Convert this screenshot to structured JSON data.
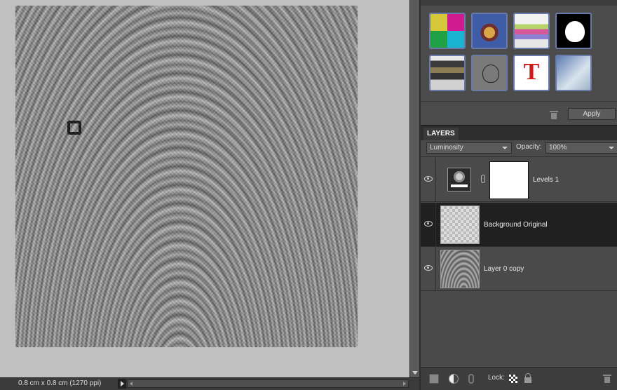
{
  "status": {
    "doc_size": "0.8 cm x 0.8 cm (1270 ppi)"
  },
  "effects": {
    "thumbnails": [
      "effect-thumb-1",
      "effect-thumb-2",
      "effect-thumb-3",
      "effect-thumb-4",
      "effect-thumb-5",
      "effect-thumb-6",
      "effect-thumb-7",
      "effect-thumb-8"
    ],
    "text_effect_glyph": "T",
    "apply_label": "Apply"
  },
  "layers": {
    "tab_label": "LAYERS",
    "blend_mode": "Luminosity",
    "opacity_label": "Opacity:",
    "opacity_value": "100%",
    "items": [
      {
        "name": "Levels 1",
        "selected": false
      },
      {
        "name": "Background Original",
        "selected": true
      },
      {
        "name": "Layer 0 copy",
        "selected": false
      }
    ],
    "lock_label": "Lock:"
  },
  "colors": {
    "selected_row": "#202020",
    "thumb_border": "#6a7aa8",
    "panel_bg": "#4a4a4a"
  }
}
